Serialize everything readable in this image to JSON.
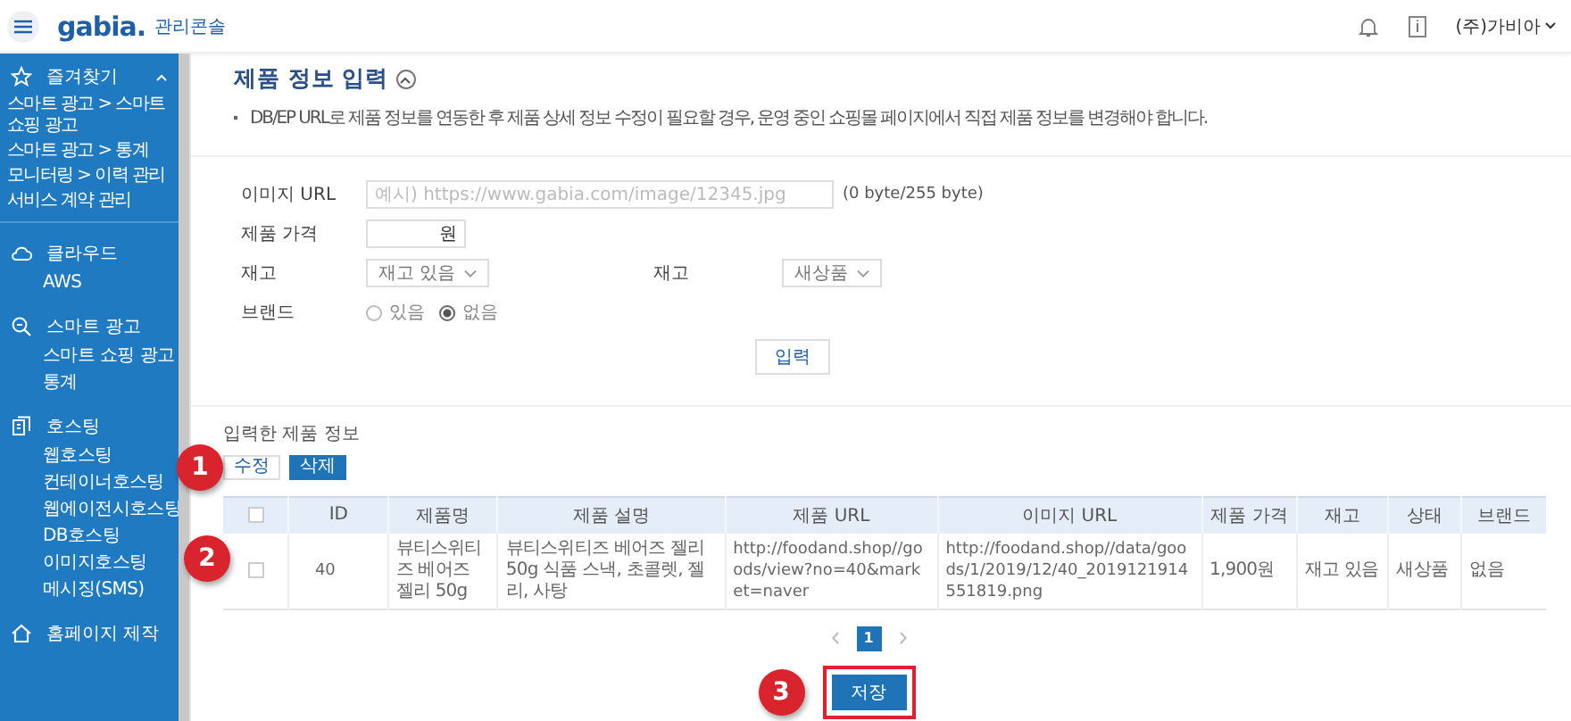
{
  "header": {
    "logo": "gabia.",
    "console": "관리콘솔",
    "user": "(주)가비아"
  },
  "sidebar": {
    "sections": [
      {
        "title": "즐겨찾기",
        "expanded": true,
        "items": [
          "스마트 광고 > 스마트 쇼핑 광고",
          "스마트 광고 > 통계",
          "모니터링 > 이력 관리",
          "서비스 계약 관리"
        ]
      },
      {
        "title": "클라우드",
        "items": [
          "AWS"
        ]
      },
      {
        "title": "스마트 광고",
        "items": [
          "스마트 쇼핑 광고",
          "통계"
        ]
      },
      {
        "title": "호스팅",
        "items": [
          "웹호스팅",
          "컨테이너호스팅",
          "웹에이전시호스팅",
          "DB호스팅",
          "이미지호스팅",
          "메시징(SMS)"
        ]
      },
      {
        "title": "홈페이지 제작"
      }
    ]
  },
  "page": {
    "title": "제품 정보 입력",
    "expanded": true,
    "notice": "DB/EP URL로 제품 정보를 연동한 후 제품 상세 정보 수정이 필요할 경우, 운영 중인 쇼핑몰 페이지에서 직접 제품 정보를 변경해야 합니다."
  },
  "form": {
    "image_url": {
      "label": "이미지 URL",
      "placeholder": "예시) https://www.gabia.com/image/12345.jpg",
      "counter": "(0 byte/255 byte)"
    },
    "price": {
      "label": "제품 가격",
      "unit": "원"
    },
    "stock": {
      "label": "재고",
      "value": "재고 있음"
    },
    "condition": {
      "label": "재고",
      "value": "새상품"
    },
    "brand": {
      "label": "브랜드",
      "options": [
        {
          "label": "있음",
          "selected": false
        },
        {
          "label": "없음",
          "selected": true
        }
      ]
    },
    "submit": "입력"
  },
  "list": {
    "title": "입력한 제품 정보",
    "buttons": [
      {
        "label": "수정",
        "kind": "outline"
      },
      {
        "label": "삭제",
        "kind": "primary"
      }
    ],
    "table": {
      "all_checked": false,
      "columns": [
        "ID",
        "제품명",
        "제품 설명",
        "제품 URL",
        "이미지 URL",
        "제품 가격",
        "재고",
        "상태",
        "브랜드"
      ],
      "rows": [
        {
          "checked": false,
          "cells": [
            "40",
            "뷰티스위티즈 베어즈 젤리 50g",
            "뷰티스위티즈 베어즈 젤리 50g 식품 스낵, 초콜렛, 젤리, 사탕",
            "http://foodand.shop//goods/view?no=40&market=naver",
            "http://foodand.shop//data/goods/1/2019/12/40_2019121914551819.png",
            "1,900원",
            "재고 있음",
            "새상품",
            "없음"
          ]
        }
      ]
    },
    "pagination": {
      "pages": [
        {
          "label": "1",
          "selected": true
        }
      ]
    },
    "save": {
      "label": "저장",
      "highlighted": true
    }
  },
  "callouts": [
    "1",
    "2",
    "3"
  ]
}
